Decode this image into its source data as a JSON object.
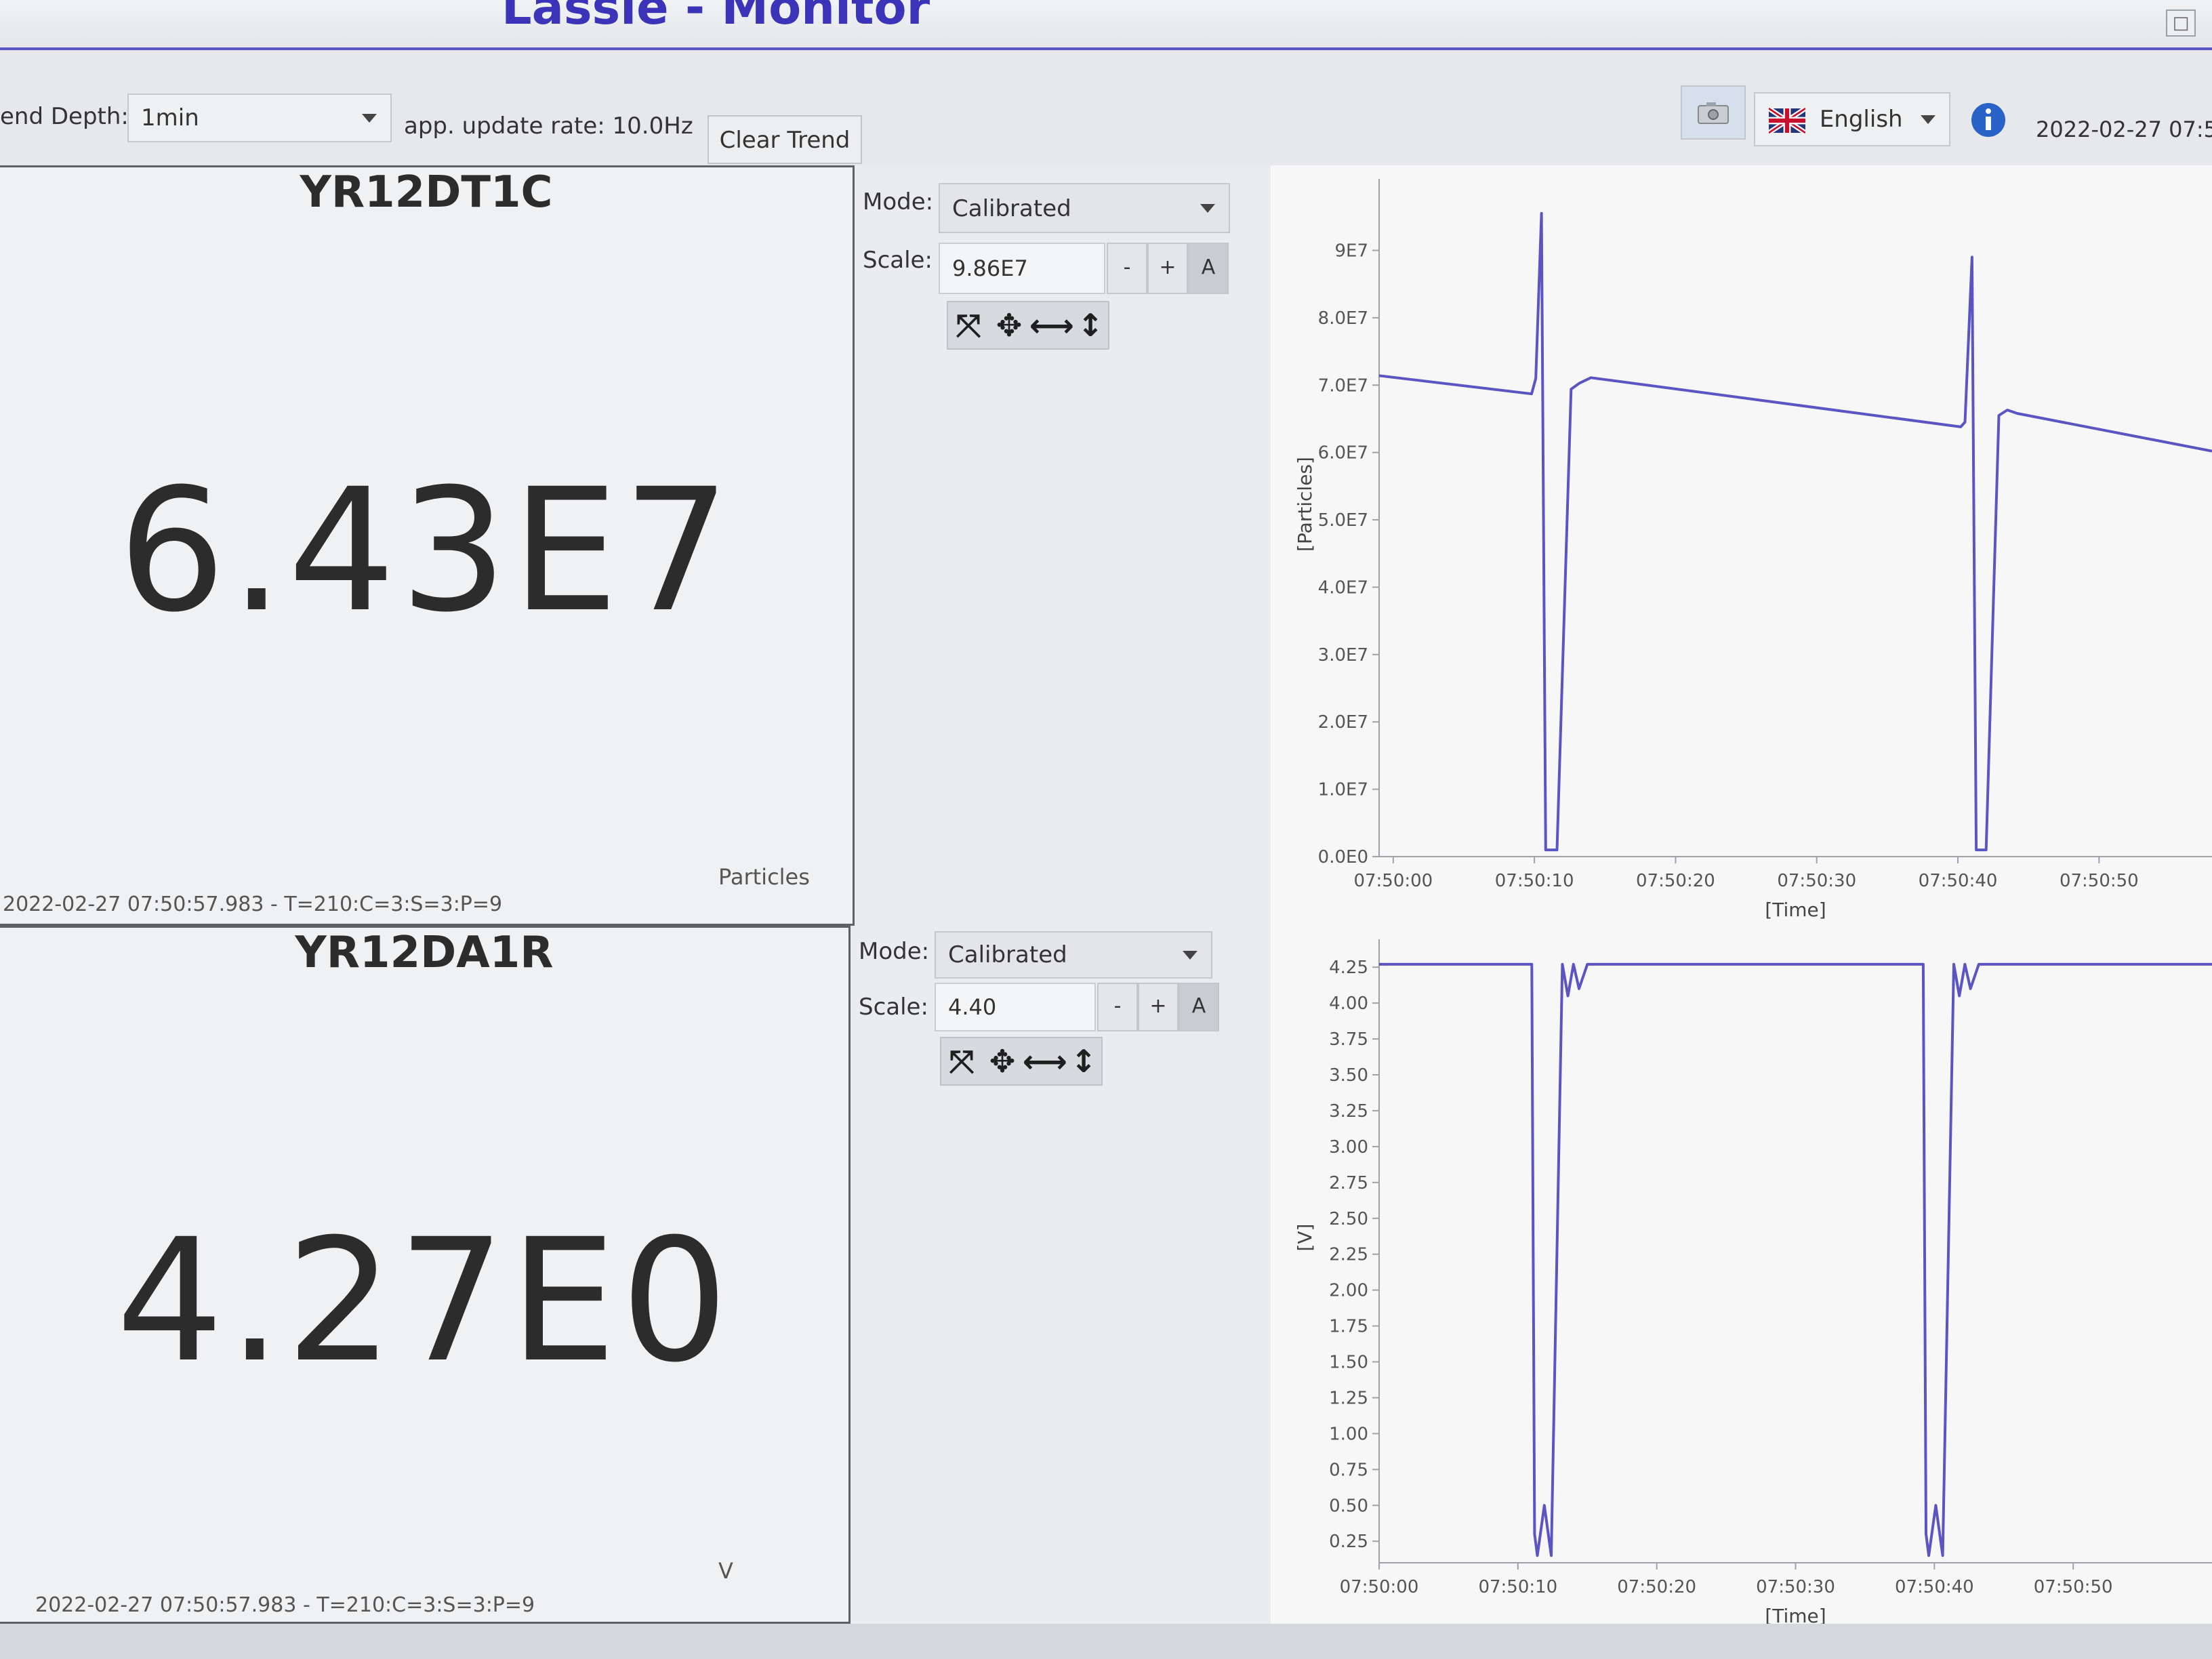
{
  "app": {
    "title": "Lassie - Monitor"
  },
  "toolbar": {
    "trend_depth_label": "end Depth:",
    "trend_depth_value": "1min",
    "update_rate": "app. update rate: 10.0Hz",
    "clear_trend": "Clear Trend",
    "language": "English",
    "datetime": "2022-02-27 07:50:5"
  },
  "devices": [
    {
      "name": "YR12DT1C",
      "value": "6.43E7",
      "unit": "Particles",
      "timestamp": "2022-02-27 07:50:57.983 - T=210:C=3:S=3:P=9",
      "mode_label": "Mode:",
      "mode_value": "Calibrated",
      "scale_label": "Scale:",
      "scale_value": "9.86E7",
      "minus": "-",
      "plus": "+",
      "auto": "A"
    },
    {
      "name": "YR12DA1R",
      "value": "4.27E0",
      "unit": "V",
      "timestamp": "2022-02-27 07:50:57.983 - T=210:C=3:S=3:P=9",
      "mode_label": "Mode:",
      "mode_value": "Calibrated",
      "scale_label": "Scale:",
      "scale_value": "4.40",
      "minus": "-",
      "plus": "+",
      "auto": "A"
    }
  ],
  "colors": {
    "trace": "#5b55c4",
    "accent": "#3b34b8",
    "info": "#2a63c8"
  },
  "icons": [
    "camera-icon",
    "uk-flag-icon",
    "info-icon",
    "fit-icon",
    "pan-icon",
    "horizontal-zoom-icon",
    "vertical-zoom-icon"
  ],
  "chart_data": [
    {
      "type": "line",
      "title": "",
      "xlabel": "[Time]",
      "ylabel": "[Particles]",
      "xticks": [
        "07:50:00",
        "07:50:10",
        "07:50:20",
        "07:50:30",
        "07:50:40",
        "07:50:50"
      ],
      "yticks": [
        "0.0E0",
        "1.0E7",
        "2.0E7",
        "3.0E7",
        "4.0E7",
        "5.0E7",
        "6.0E7",
        "7.0E7",
        "8.0E7",
        "9E7"
      ],
      "ylim": [
        0,
        98600000
      ],
      "xlim": [
        -1,
        58
      ],
      "grid": false,
      "series": [
        {
          "x": [
            -1,
            9.8,
            10.1,
            10.5,
            10.8,
            11.6,
            12.6,
            13.2,
            14.0,
            40.2,
            40.5,
            41.0,
            41.3,
            42.0,
            42.9,
            43.5,
            44.2,
            58
          ],
          "values": [
            71400000,
            68700000,
            71000000,
            95500000,
            1000000,
            1000000,
            69400000,
            70300000,
            71100000,
            63800000,
            64500000,
            89000000,
            1000000,
            1000000,
            65500000,
            66300000,
            65800000,
            60200000
          ]
        }
      ]
    },
    {
      "type": "line",
      "title": "",
      "xlabel": "[Time]",
      "ylabel": "[V]",
      "xticks": [
        "07:50:00",
        "07:50:10",
        "07:50:20",
        "07:50:30",
        "07:50:40",
        "07:50:50"
      ],
      "yticks": [
        "0.25",
        "0.50",
        "0.75",
        "1.00",
        "1.25",
        "1.50",
        "1.75",
        "2.00",
        "2.25",
        "2.50",
        "2.75",
        "3.00",
        "3.25",
        "3.50",
        "3.75",
        "4.00",
        "4.25"
      ],
      "ylim": [
        0.1,
        4.35
      ],
      "xlim": [
        0,
        60
      ],
      "grid": false,
      "series": [
        {
          "x": [
            0,
            11,
            11.2,
            11.4,
            11.9,
            12.4,
            13.2,
            13.6,
            14.0,
            14.4,
            15.0,
            39.2,
            39.4,
            39.6,
            40.1,
            40.6,
            41.4,
            41.8,
            42.2,
            42.6,
            43.2,
            60
          ],
          "values": [
            4.27,
            4.27,
            0.3,
            0.15,
            0.5,
            0.15,
            4.27,
            4.05,
            4.27,
            4.1,
            4.27,
            4.27,
            0.3,
            0.15,
            0.5,
            0.15,
            4.27,
            4.05,
            4.27,
            4.1,
            4.27,
            4.27
          ]
        }
      ]
    }
  ]
}
